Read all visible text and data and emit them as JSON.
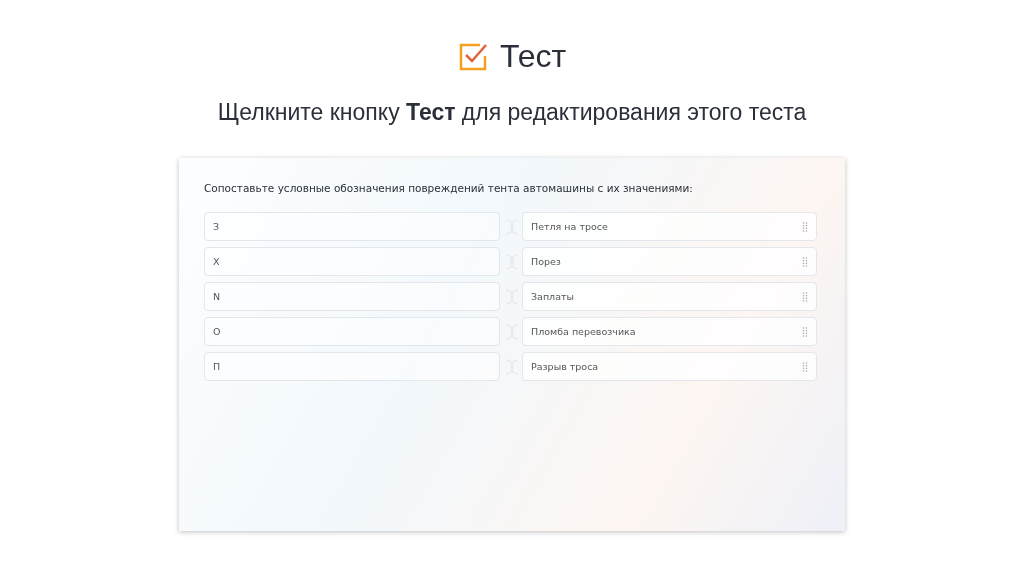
{
  "header": {
    "title": "Тест",
    "subtitle": "Щелкните кнопку **Тест** для редактирования этого теста"
  },
  "quiz": {
    "question": "Сопоставьте условные обозначения повреждений тента автомашины с их значениями:",
    "pairs": [
      {
        "left": "З",
        "right": "Петля на тросе"
      },
      {
        "left": "Х",
        "right": "Порез"
      },
      {
        "left": "N",
        "right": "Заплаты"
      },
      {
        "left": "О",
        "right": "Пломба перевозчика"
      },
      {
        "left": "П",
        "right": "Разрыв троса"
      }
    ]
  }
}
